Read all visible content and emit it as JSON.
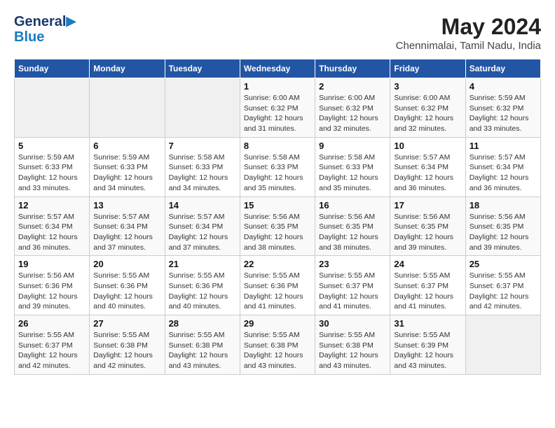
{
  "header": {
    "logo_line1": "General",
    "logo_line2": "Blue",
    "month_year": "May 2024",
    "location": "Chennimalai, Tamil Nadu, India"
  },
  "weekdays": [
    "Sunday",
    "Monday",
    "Tuesday",
    "Wednesday",
    "Thursday",
    "Friday",
    "Saturday"
  ],
  "weeks": [
    [
      {
        "day": "",
        "sunrise": "",
        "sunset": "",
        "daylight": ""
      },
      {
        "day": "",
        "sunrise": "",
        "sunset": "",
        "daylight": ""
      },
      {
        "day": "",
        "sunrise": "",
        "sunset": "",
        "daylight": ""
      },
      {
        "day": "1",
        "sunrise": "Sunrise: 6:00 AM",
        "sunset": "Sunset: 6:32 PM",
        "daylight": "Daylight: 12 hours and 31 minutes."
      },
      {
        "day": "2",
        "sunrise": "Sunrise: 6:00 AM",
        "sunset": "Sunset: 6:32 PM",
        "daylight": "Daylight: 12 hours and 32 minutes."
      },
      {
        "day": "3",
        "sunrise": "Sunrise: 6:00 AM",
        "sunset": "Sunset: 6:32 PM",
        "daylight": "Daylight: 12 hours and 32 minutes."
      },
      {
        "day": "4",
        "sunrise": "Sunrise: 5:59 AM",
        "sunset": "Sunset: 6:32 PM",
        "daylight": "Daylight: 12 hours and 33 minutes."
      }
    ],
    [
      {
        "day": "5",
        "sunrise": "Sunrise: 5:59 AM",
        "sunset": "Sunset: 6:33 PM",
        "daylight": "Daylight: 12 hours and 33 minutes."
      },
      {
        "day": "6",
        "sunrise": "Sunrise: 5:59 AM",
        "sunset": "Sunset: 6:33 PM",
        "daylight": "Daylight: 12 hours and 34 minutes."
      },
      {
        "day": "7",
        "sunrise": "Sunrise: 5:58 AM",
        "sunset": "Sunset: 6:33 PM",
        "daylight": "Daylight: 12 hours and 34 minutes."
      },
      {
        "day": "8",
        "sunrise": "Sunrise: 5:58 AM",
        "sunset": "Sunset: 6:33 PM",
        "daylight": "Daylight: 12 hours and 35 minutes."
      },
      {
        "day": "9",
        "sunrise": "Sunrise: 5:58 AM",
        "sunset": "Sunset: 6:33 PM",
        "daylight": "Daylight: 12 hours and 35 minutes."
      },
      {
        "day": "10",
        "sunrise": "Sunrise: 5:57 AM",
        "sunset": "Sunset: 6:34 PM",
        "daylight": "Daylight: 12 hours and 36 minutes."
      },
      {
        "day": "11",
        "sunrise": "Sunrise: 5:57 AM",
        "sunset": "Sunset: 6:34 PM",
        "daylight": "Daylight: 12 hours and 36 minutes."
      }
    ],
    [
      {
        "day": "12",
        "sunrise": "Sunrise: 5:57 AM",
        "sunset": "Sunset: 6:34 PM",
        "daylight": "Daylight: 12 hours and 36 minutes."
      },
      {
        "day": "13",
        "sunrise": "Sunrise: 5:57 AM",
        "sunset": "Sunset: 6:34 PM",
        "daylight": "Daylight: 12 hours and 37 minutes."
      },
      {
        "day": "14",
        "sunrise": "Sunrise: 5:57 AM",
        "sunset": "Sunset: 6:34 PM",
        "daylight": "Daylight: 12 hours and 37 minutes."
      },
      {
        "day": "15",
        "sunrise": "Sunrise: 5:56 AM",
        "sunset": "Sunset: 6:35 PM",
        "daylight": "Daylight: 12 hours and 38 minutes."
      },
      {
        "day": "16",
        "sunrise": "Sunrise: 5:56 AM",
        "sunset": "Sunset: 6:35 PM",
        "daylight": "Daylight: 12 hours and 38 minutes."
      },
      {
        "day": "17",
        "sunrise": "Sunrise: 5:56 AM",
        "sunset": "Sunset: 6:35 PM",
        "daylight": "Daylight: 12 hours and 39 minutes."
      },
      {
        "day": "18",
        "sunrise": "Sunrise: 5:56 AM",
        "sunset": "Sunset: 6:35 PM",
        "daylight": "Daylight: 12 hours and 39 minutes."
      }
    ],
    [
      {
        "day": "19",
        "sunrise": "Sunrise: 5:56 AM",
        "sunset": "Sunset: 6:36 PM",
        "daylight": "Daylight: 12 hours and 39 minutes."
      },
      {
        "day": "20",
        "sunrise": "Sunrise: 5:55 AM",
        "sunset": "Sunset: 6:36 PM",
        "daylight": "Daylight: 12 hours and 40 minutes."
      },
      {
        "day": "21",
        "sunrise": "Sunrise: 5:55 AM",
        "sunset": "Sunset: 6:36 PM",
        "daylight": "Daylight: 12 hours and 40 minutes."
      },
      {
        "day": "22",
        "sunrise": "Sunrise: 5:55 AM",
        "sunset": "Sunset: 6:36 PM",
        "daylight": "Daylight: 12 hours and 41 minutes."
      },
      {
        "day": "23",
        "sunrise": "Sunrise: 5:55 AM",
        "sunset": "Sunset: 6:37 PM",
        "daylight": "Daylight: 12 hours and 41 minutes."
      },
      {
        "day": "24",
        "sunrise": "Sunrise: 5:55 AM",
        "sunset": "Sunset: 6:37 PM",
        "daylight": "Daylight: 12 hours and 41 minutes."
      },
      {
        "day": "25",
        "sunrise": "Sunrise: 5:55 AM",
        "sunset": "Sunset: 6:37 PM",
        "daylight": "Daylight: 12 hours and 42 minutes."
      }
    ],
    [
      {
        "day": "26",
        "sunrise": "Sunrise: 5:55 AM",
        "sunset": "Sunset: 6:37 PM",
        "daylight": "Daylight: 12 hours and 42 minutes."
      },
      {
        "day": "27",
        "sunrise": "Sunrise: 5:55 AM",
        "sunset": "Sunset: 6:38 PM",
        "daylight": "Daylight: 12 hours and 42 minutes."
      },
      {
        "day": "28",
        "sunrise": "Sunrise: 5:55 AM",
        "sunset": "Sunset: 6:38 PM",
        "daylight": "Daylight: 12 hours and 43 minutes."
      },
      {
        "day": "29",
        "sunrise": "Sunrise: 5:55 AM",
        "sunset": "Sunset: 6:38 PM",
        "daylight": "Daylight: 12 hours and 43 minutes."
      },
      {
        "day": "30",
        "sunrise": "Sunrise: 5:55 AM",
        "sunset": "Sunset: 6:38 PM",
        "daylight": "Daylight: 12 hours and 43 minutes."
      },
      {
        "day": "31",
        "sunrise": "Sunrise: 5:55 AM",
        "sunset": "Sunset: 6:39 PM",
        "daylight": "Daylight: 12 hours and 43 minutes."
      },
      {
        "day": "",
        "sunrise": "",
        "sunset": "",
        "daylight": ""
      }
    ]
  ]
}
